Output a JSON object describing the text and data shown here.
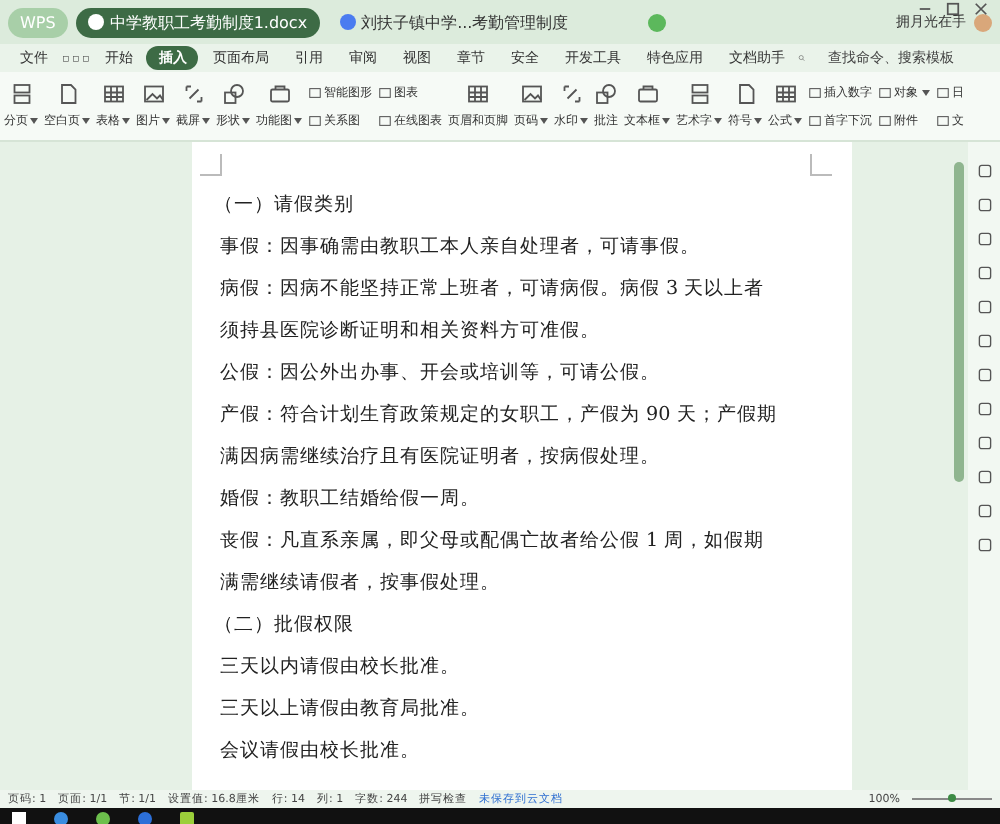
{
  "tabs": [
    {
      "kind": "home",
      "label": "WPS",
      "selected": false
    },
    {
      "kind": "doc",
      "label": "中学教职工考勤制度1.docx",
      "selected": true
    },
    {
      "kind": "doc",
      "label": "刘扶子镇中学...考勤管理制度",
      "selected": false
    }
  ],
  "user": {
    "name": "拥月光在手"
  },
  "file_menu": "文件",
  "menu": [
    {
      "label": "开始",
      "selected": false
    },
    {
      "label": "插入",
      "selected": true
    },
    {
      "label": "页面布局",
      "selected": false
    },
    {
      "label": "引用",
      "selected": false
    },
    {
      "label": "审阅",
      "selected": false
    },
    {
      "label": "视图",
      "selected": false
    },
    {
      "label": "章节",
      "selected": false
    },
    {
      "label": "安全",
      "selected": false
    },
    {
      "label": "开发工具",
      "selected": false
    },
    {
      "label": "特色应用",
      "selected": false
    },
    {
      "label": "文档助手",
      "selected": false
    }
  ],
  "search": {
    "placeholder": "查找命令、搜索模板"
  },
  "ribbon": [
    {
      "kind": "large",
      "label": "分页",
      "caret": true
    },
    {
      "kind": "large",
      "label": "空白页",
      "caret": true
    },
    {
      "kind": "large",
      "label": "表格",
      "caret": true
    },
    {
      "kind": "large",
      "label": "图片",
      "caret": true
    },
    {
      "kind": "large",
      "label": "截屏",
      "caret": true
    },
    {
      "kind": "large",
      "label": "形状",
      "caret": true
    },
    {
      "kind": "large",
      "label": "功能图",
      "caret": true
    },
    {
      "kind": "pair",
      "items": [
        {
          "label": "智能图形",
          "caret": false
        },
        {
          "label": "关系图",
          "caret": false
        }
      ]
    },
    {
      "kind": "pair",
      "items": [
        {
          "label": "图表",
          "caret": false
        },
        {
          "label": "在线图表",
          "caret": false
        }
      ]
    },
    {
      "kind": "large",
      "label": "页眉和页脚",
      "caret": false
    },
    {
      "kind": "large",
      "label": "页码",
      "caret": true
    },
    {
      "kind": "large",
      "label": "水印",
      "caret": true
    },
    {
      "kind": "large",
      "label": "批注",
      "caret": false
    },
    {
      "kind": "large",
      "label": "文本框",
      "caret": true
    },
    {
      "kind": "large",
      "label": "艺术字",
      "caret": true
    },
    {
      "kind": "large",
      "label": "符号",
      "caret": true
    },
    {
      "kind": "large",
      "label": "公式",
      "caret": true
    },
    {
      "kind": "pair",
      "items": [
        {
          "label": "插入数字",
          "caret": false
        },
        {
          "label": "首字下沉",
          "caret": false
        }
      ]
    },
    {
      "kind": "pair",
      "items": [
        {
          "label": "对象",
          "caret": true
        },
        {
          "label": "附件",
          "caret": false
        }
      ]
    },
    {
      "kind": "pair",
      "items": [
        {
          "label": "日",
          "caret": false
        },
        {
          "label": "文",
          "caret": false
        }
      ]
    }
  ],
  "document": [
    {
      "kind": "heading",
      "text": "（一）请假类别"
    },
    {
      "kind": "body",
      "text": "事假：因事确需由教职工本人亲自处理者，可请事假。"
    },
    {
      "kind": "body",
      "text": "病假：因病不能坚持正常上班者，可请病假。病假 3 天以上者须持县医院诊断证明和相关资料方可准假。"
    },
    {
      "kind": "body",
      "text": "公假：因公外出办事、开会或培训等，可请公假。"
    },
    {
      "kind": "body",
      "text": "产假：符合计划生育政策规定的女职工，产假为 90 天；产假期满因病需继续治疗且有医院证明者，按病假处理。"
    },
    {
      "kind": "body",
      "text": "婚假：教职工结婚给假一周。"
    },
    {
      "kind": "body",
      "text": "丧假：凡直系亲属，即父母或配偶亡故者给公假 1 周，如假期满需继续请假者，按事假处理。"
    },
    {
      "kind": "heading",
      "text": "（二）批假权限"
    },
    {
      "kind": "body",
      "text": "三天以内请假由校长批准。"
    },
    {
      "kind": "body",
      "text": "三天以上请假由教育局批准。"
    },
    {
      "kind": "body",
      "text": "会议请假由校长批准。"
    }
  ],
  "status_bar": {
    "items": [
      "页码: 1",
      "页面: 1/1",
      "节: 1/1",
      "设置值: 16.8厘米",
      "行: 14",
      "列: 1",
      "字数: 244"
    ],
    "spell_check": "拼写检查",
    "cloud": "未保存到云文档",
    "zoom": "100%",
    "zoom_slider": {
      "level": 0.5
    }
  }
}
